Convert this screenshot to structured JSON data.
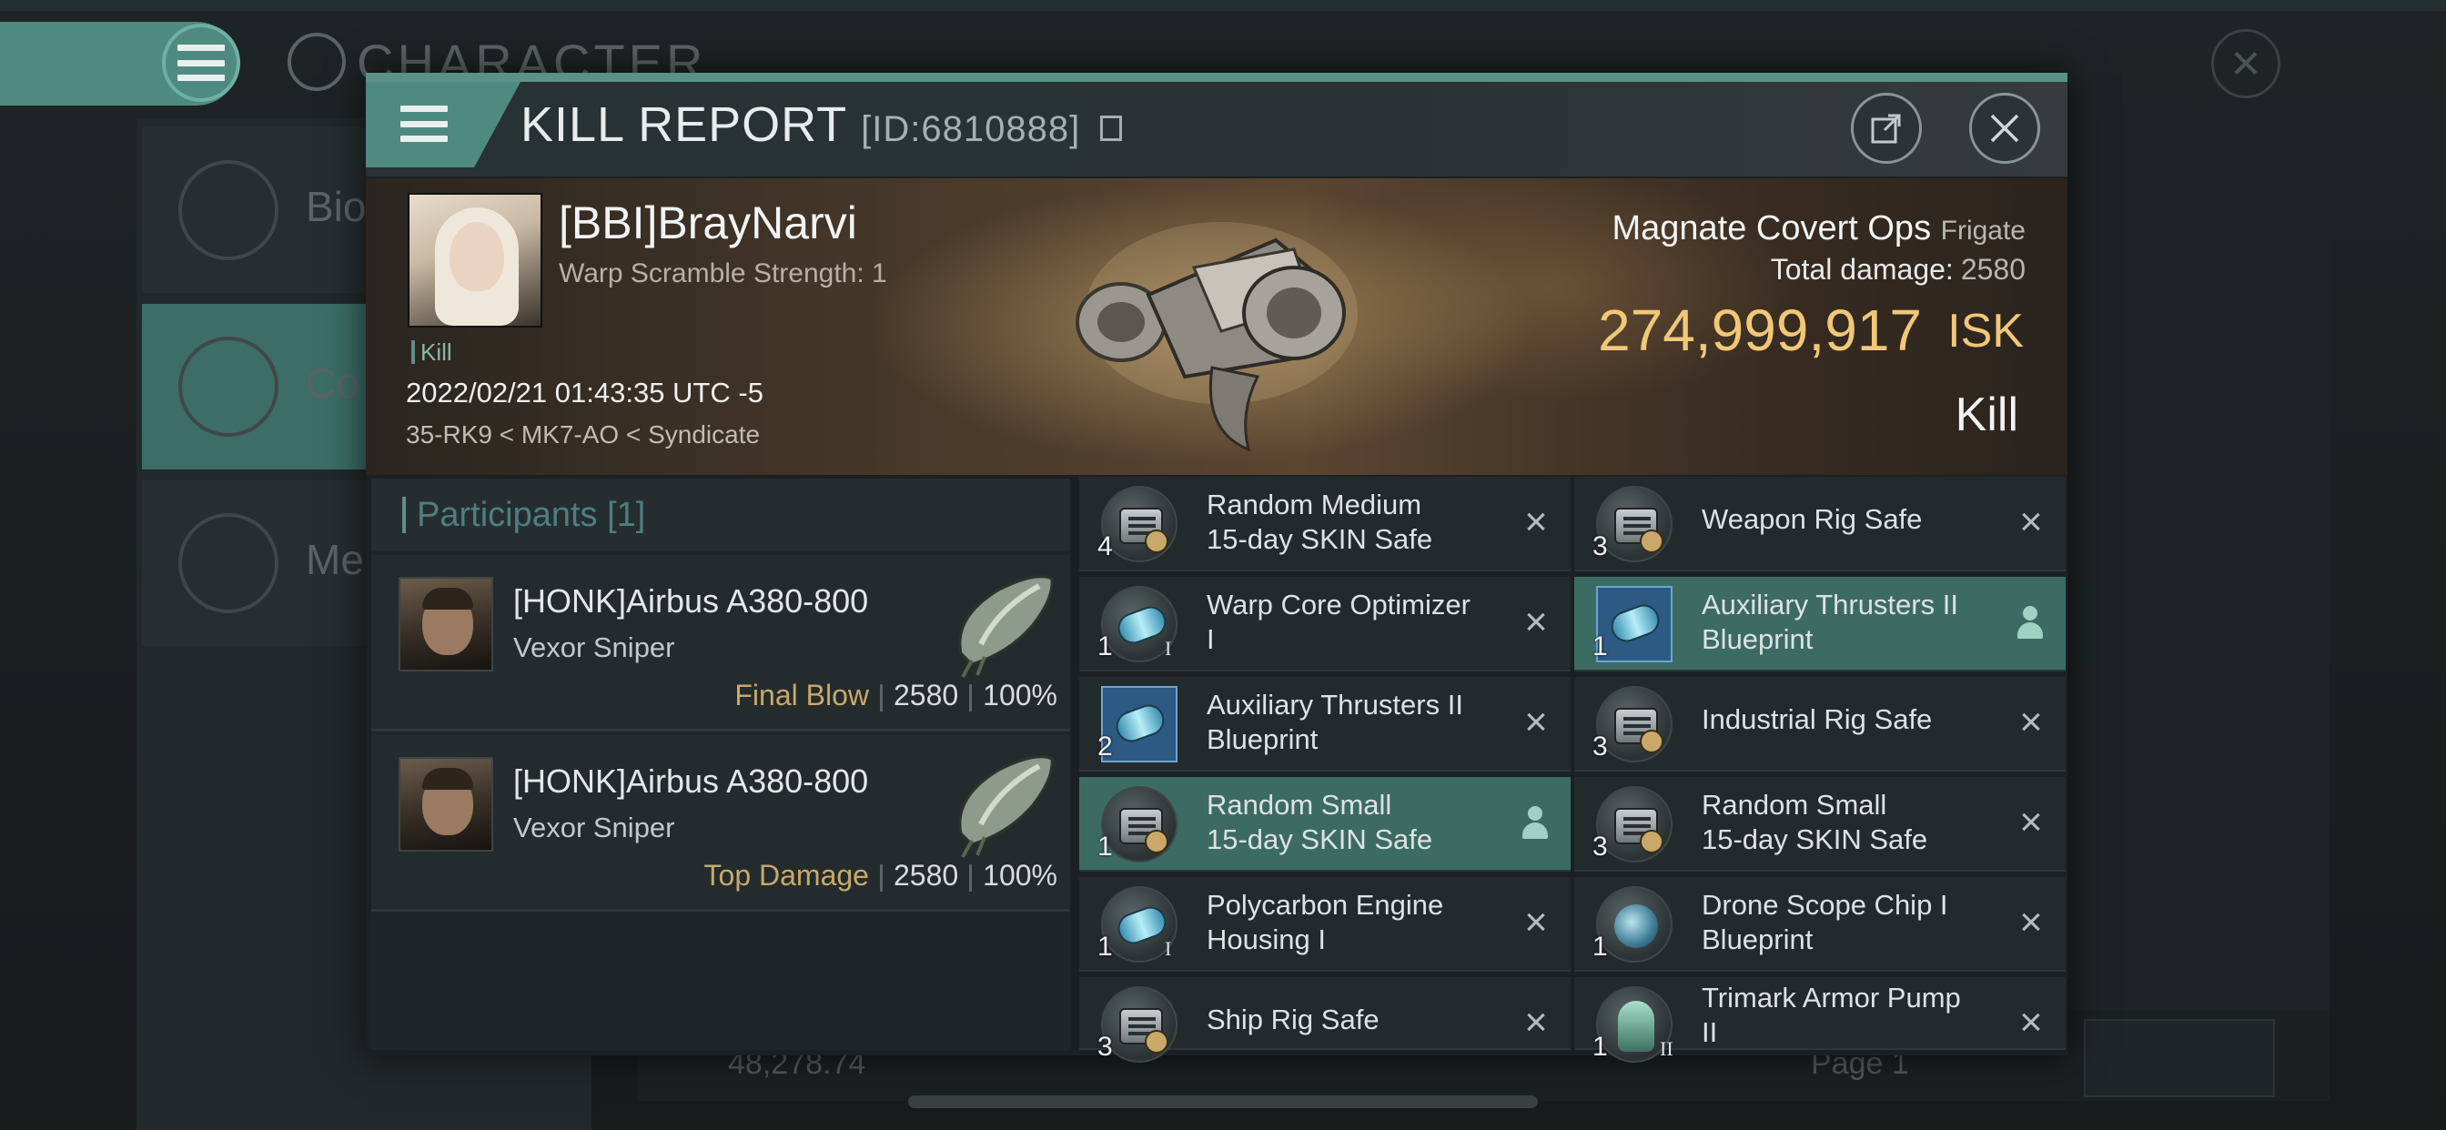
{
  "background": {
    "title": "CHARACTER",
    "side_items": [
      "Bio",
      "Co",
      "Me"
    ],
    "balance": "48,278.74",
    "page_label": "Page 1"
  },
  "dialog": {
    "title": "KILL REPORT",
    "id": "[ID:6810888]"
  },
  "victim": {
    "name": "[BBI]BrayNarvi",
    "sub": "Warp Scramble Strength: 1",
    "tag": "Kill",
    "datetime": "2022/02/21 01:43:35 UTC -5",
    "location": "35-RK9 < MK7-AO < Syndicate",
    "ship": "Magnate Covert Ops",
    "ship_class": "Frigate",
    "total_damage_label": "Total damage:",
    "total_damage": "2580",
    "isk_value": "274,999,917",
    "isk_unit": "ISK",
    "result": "Kill"
  },
  "participants": {
    "header": "Participants [1]",
    "rows": [
      {
        "name": "[HONK]Airbus A380-800",
        "ship": "Vexor Sniper",
        "tag": "Final Blow",
        "damage": "2580",
        "percent": "100%"
      },
      {
        "name": "[HONK]Airbus A380-800",
        "ship": "Vexor Sniper",
        "tag": "Top Damage",
        "damage": "2580",
        "percent": "100%"
      }
    ]
  },
  "items": {
    "left": [
      {
        "qty": "4",
        "name": "Random Medium",
        "name2": "15-day SKIN Safe",
        "icon": "safe-icon",
        "highlighted": false
      },
      {
        "qty": "1",
        "name": "Warp Core Optimizer",
        "name2": "I",
        "icon": "thruster-icon",
        "highlighted": false
      },
      {
        "qty": "2",
        "name": "Auxiliary Thrusters II",
        "name2": "Blueprint",
        "icon": "blueprint-icon",
        "highlighted": false
      },
      {
        "qty": "1",
        "name": "Random Small",
        "name2": "15-day SKIN Safe",
        "icon": "safe-icon",
        "highlighted": true
      },
      {
        "qty": "1",
        "name": "Polycarbon Engine",
        "name2": "Housing I",
        "icon": "thruster-icon",
        "highlighted": false
      },
      {
        "qty": "3",
        "name": "Ship Rig Safe",
        "name2": "",
        "icon": "safe-icon",
        "highlighted": false
      }
    ],
    "right": [
      {
        "qty": "3",
        "name": "Weapon Rig Safe",
        "name2": "",
        "icon": "safe-icon",
        "highlighted": false
      },
      {
        "qty": "1",
        "name": "Auxiliary Thrusters II",
        "name2": "Blueprint",
        "icon": "blueprint-icon",
        "highlighted": true
      },
      {
        "qty": "3",
        "name": "Industrial Rig Safe",
        "name2": "",
        "icon": "safe-icon",
        "highlighted": false
      },
      {
        "qty": "3",
        "name": "Random Small",
        "name2": "15-day SKIN Safe",
        "icon": "safe-icon",
        "highlighted": false
      },
      {
        "qty": "1",
        "name": "Drone Scope Chip I",
        "name2": "Blueprint",
        "icon": "chip-icon",
        "highlighted": false
      },
      {
        "qty": "1",
        "name": "Trimark Armor Pump",
        "name2": "II",
        "icon": "armor-pump-icon",
        "highlighted": false
      }
    ]
  },
  "colors": {
    "accent": "#5b9187",
    "isk": "#f0c878",
    "highlight_row": "#3c6b64"
  }
}
